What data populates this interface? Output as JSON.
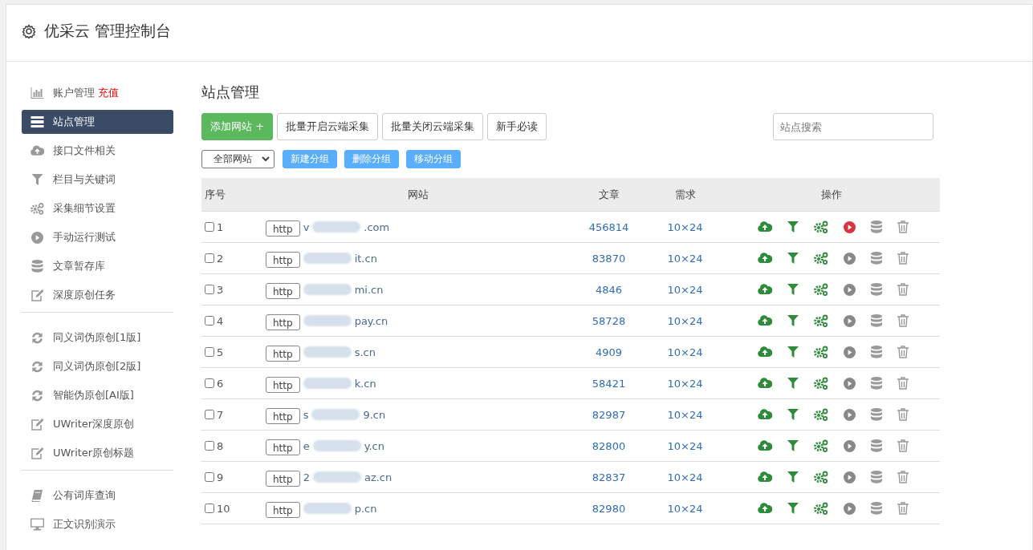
{
  "header": {
    "title": "优采云 管理控制台"
  },
  "sidebar": {
    "groups": [
      {
        "items": [
          {
            "label": "账户管理",
            "badge": "充值",
            "selected": false
          },
          {
            "label": "站点管理",
            "selected": true
          },
          {
            "label": "接口文件相关",
            "selected": false
          },
          {
            "label": "栏目与关键词",
            "selected": false
          },
          {
            "label": "采集细节设置",
            "selected": false
          },
          {
            "label": "手动运行测试",
            "selected": false
          },
          {
            "label": "文章暂存库",
            "selected": false
          },
          {
            "label": "深度原创任务",
            "selected": false
          }
        ]
      },
      {
        "items": [
          {
            "label": "同义词伪原创[1版]",
            "selected": false
          },
          {
            "label": "同义词伪原创[2版]",
            "selected": false
          },
          {
            "label": "智能伪原创[AI版]",
            "selected": false
          },
          {
            "label": "UWriter深度原创",
            "selected": false
          },
          {
            "label": "UWriter原创标题",
            "selected": false
          }
        ]
      },
      {
        "items": [
          {
            "label": "公有词库查询",
            "selected": false
          },
          {
            "label": "正文识别演示",
            "selected": false
          }
        ]
      }
    ]
  },
  "main": {
    "title": "站点管理",
    "toolbar": [
      {
        "label": "添加网站 +",
        "kind": "primary"
      },
      {
        "label": "批量开启云端采集",
        "kind": "default"
      },
      {
        "label": "批量关闭云端采集",
        "kind": "default"
      },
      {
        "label": "新手必读",
        "kind": "default"
      }
    ],
    "search": {
      "placeholder": "站点搜索"
    },
    "group_select": {
      "value": "全部网站"
    },
    "group_buttons": [
      "新建分组",
      "删除分组",
      "移动分组"
    ],
    "table": {
      "columns": [
        "序号",
        "网站",
        "文章",
        "需求",
        "操作"
      ],
      "rows": [
        {
          "index": "1",
          "checked": false,
          "scheme": "http",
          "url_start": "v",
          "url_end": ".com",
          "articles": "456814",
          "demand": "10×24",
          "running": true
        },
        {
          "index": "2",
          "checked": false,
          "scheme": "http",
          "url_start": "",
          "url_end": "it.cn",
          "articles": "83870",
          "demand": "10×24",
          "running": false
        },
        {
          "index": "3",
          "checked": false,
          "scheme": "http",
          "url_start": "",
          "url_end": "mi.cn",
          "articles": "4846",
          "demand": "10×24",
          "running": false
        },
        {
          "index": "4",
          "checked": false,
          "scheme": "http",
          "url_start": "",
          "url_end": "pay.cn",
          "articles": "58728",
          "demand": "10×24",
          "running": false
        },
        {
          "index": "5",
          "checked": false,
          "scheme": "http",
          "url_start": "",
          "url_end": "s.cn",
          "articles": "4909",
          "demand": "10×24",
          "running": false
        },
        {
          "index": "6",
          "checked": false,
          "scheme": "http",
          "url_start": "",
          "url_end": "k.cn",
          "articles": "58421",
          "demand": "10×24",
          "running": false
        },
        {
          "index": "7",
          "checked": false,
          "scheme": "http",
          "url_start": "s",
          "url_end": "9.cn",
          "articles": "82987",
          "demand": "10×24",
          "running": false
        },
        {
          "index": "8",
          "checked": false,
          "scheme": "http",
          "url_start": "e",
          "url_end": "y.cn",
          "articles": "82800",
          "demand": "10×24",
          "running": false
        },
        {
          "index": "9",
          "checked": false,
          "scheme": "http",
          "url_start": "2",
          "url_end": "az.cn",
          "articles": "82837",
          "demand": "10×24",
          "running": false
        },
        {
          "index": "10",
          "checked": false,
          "scheme": "http",
          "url_start": "",
          "url_end": "p.cn",
          "articles": "82980",
          "demand": "10×24",
          "running": false
        }
      ]
    }
  }
}
